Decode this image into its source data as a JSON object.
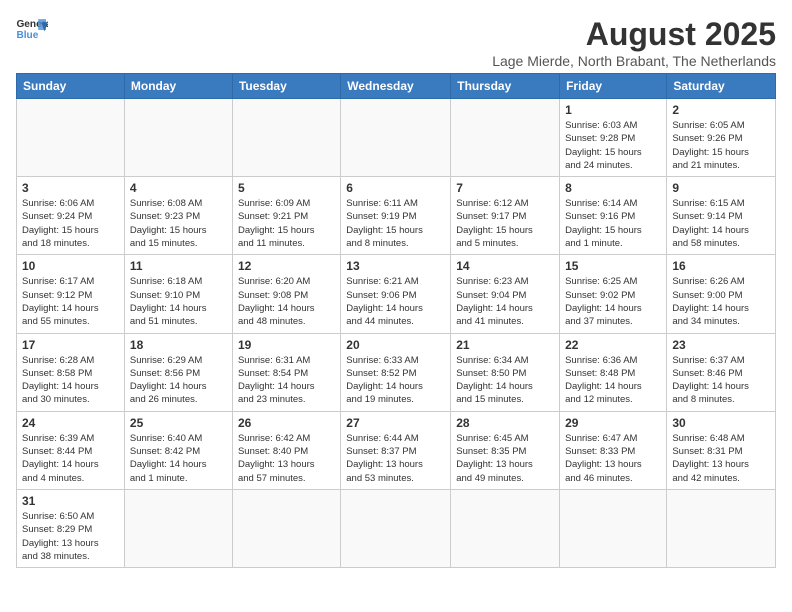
{
  "logo": {
    "line1": "General",
    "line2": "Blue"
  },
  "title": "August 2025",
  "subtitle": "Lage Mierde, North Brabant, The Netherlands",
  "headers": [
    "Sunday",
    "Monday",
    "Tuesday",
    "Wednesday",
    "Thursday",
    "Friday",
    "Saturday"
  ],
  "weeks": [
    [
      {
        "day": "",
        "info": ""
      },
      {
        "day": "",
        "info": ""
      },
      {
        "day": "",
        "info": ""
      },
      {
        "day": "",
        "info": ""
      },
      {
        "day": "",
        "info": ""
      },
      {
        "day": "1",
        "info": "Sunrise: 6:03 AM\nSunset: 9:28 PM\nDaylight: 15 hours\nand 24 minutes."
      },
      {
        "day": "2",
        "info": "Sunrise: 6:05 AM\nSunset: 9:26 PM\nDaylight: 15 hours\nand 21 minutes."
      }
    ],
    [
      {
        "day": "3",
        "info": "Sunrise: 6:06 AM\nSunset: 9:24 PM\nDaylight: 15 hours\nand 18 minutes."
      },
      {
        "day": "4",
        "info": "Sunrise: 6:08 AM\nSunset: 9:23 PM\nDaylight: 15 hours\nand 15 minutes."
      },
      {
        "day": "5",
        "info": "Sunrise: 6:09 AM\nSunset: 9:21 PM\nDaylight: 15 hours\nand 11 minutes."
      },
      {
        "day": "6",
        "info": "Sunrise: 6:11 AM\nSunset: 9:19 PM\nDaylight: 15 hours\nand 8 minutes."
      },
      {
        "day": "7",
        "info": "Sunrise: 6:12 AM\nSunset: 9:17 PM\nDaylight: 15 hours\nand 5 minutes."
      },
      {
        "day": "8",
        "info": "Sunrise: 6:14 AM\nSunset: 9:16 PM\nDaylight: 15 hours\nand 1 minute."
      },
      {
        "day": "9",
        "info": "Sunrise: 6:15 AM\nSunset: 9:14 PM\nDaylight: 14 hours\nand 58 minutes."
      }
    ],
    [
      {
        "day": "10",
        "info": "Sunrise: 6:17 AM\nSunset: 9:12 PM\nDaylight: 14 hours\nand 55 minutes."
      },
      {
        "day": "11",
        "info": "Sunrise: 6:18 AM\nSunset: 9:10 PM\nDaylight: 14 hours\nand 51 minutes."
      },
      {
        "day": "12",
        "info": "Sunrise: 6:20 AM\nSunset: 9:08 PM\nDaylight: 14 hours\nand 48 minutes."
      },
      {
        "day": "13",
        "info": "Sunrise: 6:21 AM\nSunset: 9:06 PM\nDaylight: 14 hours\nand 44 minutes."
      },
      {
        "day": "14",
        "info": "Sunrise: 6:23 AM\nSunset: 9:04 PM\nDaylight: 14 hours\nand 41 minutes."
      },
      {
        "day": "15",
        "info": "Sunrise: 6:25 AM\nSunset: 9:02 PM\nDaylight: 14 hours\nand 37 minutes."
      },
      {
        "day": "16",
        "info": "Sunrise: 6:26 AM\nSunset: 9:00 PM\nDaylight: 14 hours\nand 34 minutes."
      }
    ],
    [
      {
        "day": "17",
        "info": "Sunrise: 6:28 AM\nSunset: 8:58 PM\nDaylight: 14 hours\nand 30 minutes."
      },
      {
        "day": "18",
        "info": "Sunrise: 6:29 AM\nSunset: 8:56 PM\nDaylight: 14 hours\nand 26 minutes."
      },
      {
        "day": "19",
        "info": "Sunrise: 6:31 AM\nSunset: 8:54 PM\nDaylight: 14 hours\nand 23 minutes."
      },
      {
        "day": "20",
        "info": "Sunrise: 6:33 AM\nSunset: 8:52 PM\nDaylight: 14 hours\nand 19 minutes."
      },
      {
        "day": "21",
        "info": "Sunrise: 6:34 AM\nSunset: 8:50 PM\nDaylight: 14 hours\nand 15 minutes."
      },
      {
        "day": "22",
        "info": "Sunrise: 6:36 AM\nSunset: 8:48 PM\nDaylight: 14 hours\nand 12 minutes."
      },
      {
        "day": "23",
        "info": "Sunrise: 6:37 AM\nSunset: 8:46 PM\nDaylight: 14 hours\nand 8 minutes."
      }
    ],
    [
      {
        "day": "24",
        "info": "Sunrise: 6:39 AM\nSunset: 8:44 PM\nDaylight: 14 hours\nand 4 minutes."
      },
      {
        "day": "25",
        "info": "Sunrise: 6:40 AM\nSunset: 8:42 PM\nDaylight: 14 hours\nand 1 minute."
      },
      {
        "day": "26",
        "info": "Sunrise: 6:42 AM\nSunset: 8:40 PM\nDaylight: 13 hours\nand 57 minutes."
      },
      {
        "day": "27",
        "info": "Sunrise: 6:44 AM\nSunset: 8:37 PM\nDaylight: 13 hours\nand 53 minutes."
      },
      {
        "day": "28",
        "info": "Sunrise: 6:45 AM\nSunset: 8:35 PM\nDaylight: 13 hours\nand 49 minutes."
      },
      {
        "day": "29",
        "info": "Sunrise: 6:47 AM\nSunset: 8:33 PM\nDaylight: 13 hours\nand 46 minutes."
      },
      {
        "day": "30",
        "info": "Sunrise: 6:48 AM\nSunset: 8:31 PM\nDaylight: 13 hours\nand 42 minutes."
      }
    ],
    [
      {
        "day": "31",
        "info": "Sunrise: 6:50 AM\nSunset: 8:29 PM\nDaylight: 13 hours\nand 38 minutes."
      },
      {
        "day": "",
        "info": ""
      },
      {
        "day": "",
        "info": ""
      },
      {
        "day": "",
        "info": ""
      },
      {
        "day": "",
        "info": ""
      },
      {
        "day": "",
        "info": ""
      },
      {
        "day": "",
        "info": ""
      }
    ]
  ]
}
